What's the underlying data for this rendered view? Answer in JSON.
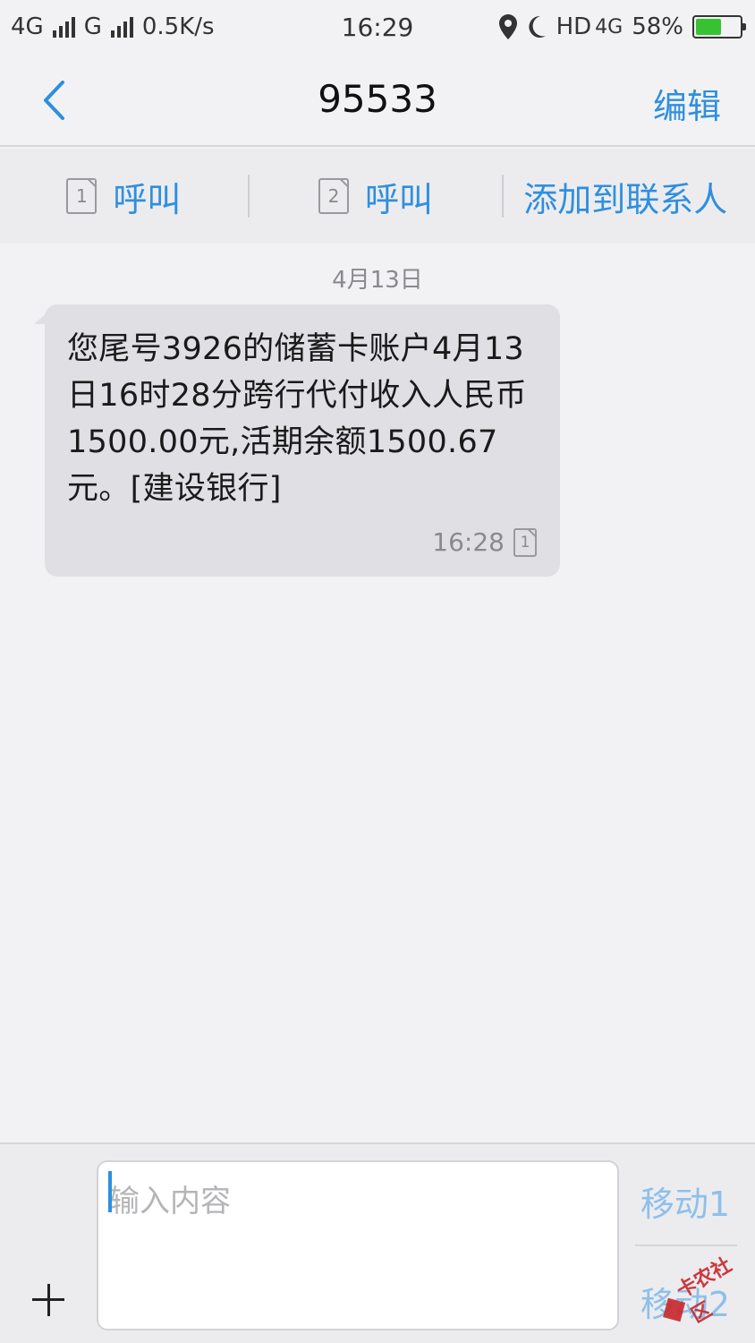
{
  "status_bar": {
    "network_1": "4G",
    "network_2": "G",
    "speed": "0.5K/s",
    "time": "16:29",
    "hd_label": "HD",
    "net_4g": "4G",
    "battery_percent": "58%",
    "battery_level": 0.58,
    "icons": [
      "signal-icon",
      "location-icon",
      "moon-icon",
      "battery-icon"
    ]
  },
  "header": {
    "title": "95533",
    "edit_label": "编辑"
  },
  "actions": {
    "call_sim1": {
      "sim": "1",
      "label": "呼叫"
    },
    "call_sim2": {
      "sim": "2",
      "label": "呼叫"
    },
    "add_contact": "添加到联系人"
  },
  "conversation": {
    "date": "4月13日",
    "messages": [
      {
        "text": "您尾号3926的储蓄卡账户4月13日16时28分跨行代付收入人民币1500.00元,活期余额1500.67元。[建设银行]",
        "time": "16:28",
        "sim": "1"
      }
    ]
  },
  "composer": {
    "placeholder": "输入内容",
    "send_sim1": "移动1",
    "send_sim2": "移动2",
    "watermark": "卡农社区"
  },
  "colors": {
    "accent": "#2f8fde",
    "bubble": "#dfdfe4",
    "background": "#f2f2f4"
  }
}
